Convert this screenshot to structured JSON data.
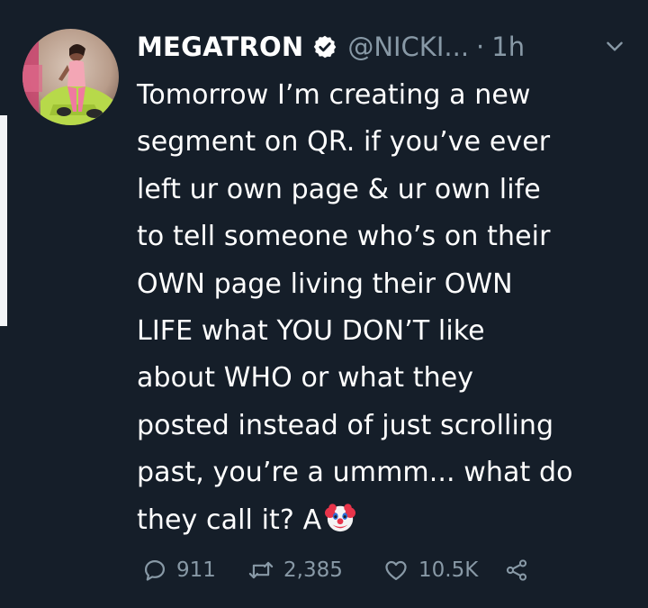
{
  "tweet": {
    "display_name": "MEGATRON",
    "handle": "@NICKI...",
    "separator": "·",
    "time": "1h",
    "lines": [
      "Tomorrow I’m creating a new",
      "segment on QR. if you’ve ever",
      "left ur own page & ur own life",
      "to tell someone who’s on their",
      "OWN page living their OWN",
      "LIFE what YOU DON’T like",
      "about WHO or what they",
      "posted instead of just scrolling",
      "past, you’re a ummm... what do",
      "they call it? A"
    ],
    "emoji": "clown-face",
    "reply_count": "911",
    "retweet_count": "2,385",
    "like_count": "10.5K"
  },
  "colors": {
    "background": "#151e29",
    "text": "#ffffff",
    "secondary": "#8899a6"
  },
  "icons": [
    "verified-badge-icon",
    "chevron-down-icon",
    "reply-icon",
    "retweet-icon",
    "like-icon",
    "share-icon"
  ]
}
